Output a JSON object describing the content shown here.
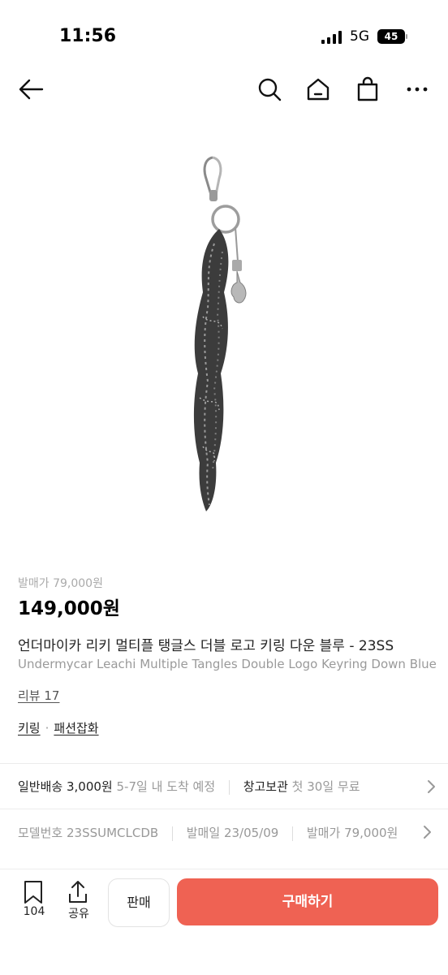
{
  "status_bar": {
    "time": "11:56",
    "network": "5G",
    "battery": "45"
  },
  "top_nav": {
    "icons": [
      "back-arrow-icon",
      "search-icon",
      "home-icon",
      "shopping-bag-icon",
      "more-icon"
    ]
  },
  "product": {
    "original_price": "발매가 79,000원",
    "price": "149,000원",
    "title_ko": "언더마이카 리키 멀티플 탱글스 더블 로고 키링 다운 블루 - 23SS",
    "title_en": "Undermycar Leachi Multiple Tangles Double Logo Keyring Down Blue",
    "review_link": "리뷰 17",
    "categories": [
      "키링",
      "패션잡화"
    ],
    "category_separator": "·"
  },
  "shipping": {
    "label": "일반배송",
    "fee": "3,000원",
    "eta": "5-7일 내 도착 예정",
    "storage_label": "창고보관",
    "storage_note": "첫 30일 무료"
  },
  "specs": {
    "model_label": "모델번호",
    "model_value": "23SSUMCLCDB",
    "release_label": "발매일",
    "release_value": "23/05/09",
    "price_label": "발매가",
    "price_value": "79,000원"
  },
  "bottom_bar": {
    "bookmark_count": "104",
    "share_label": "공유",
    "sell_label": "판매",
    "buy_label": "구매하기"
  },
  "colors": {
    "buy_button": "#ef6253",
    "muted_text": "#999999",
    "divider": "#ececec"
  }
}
